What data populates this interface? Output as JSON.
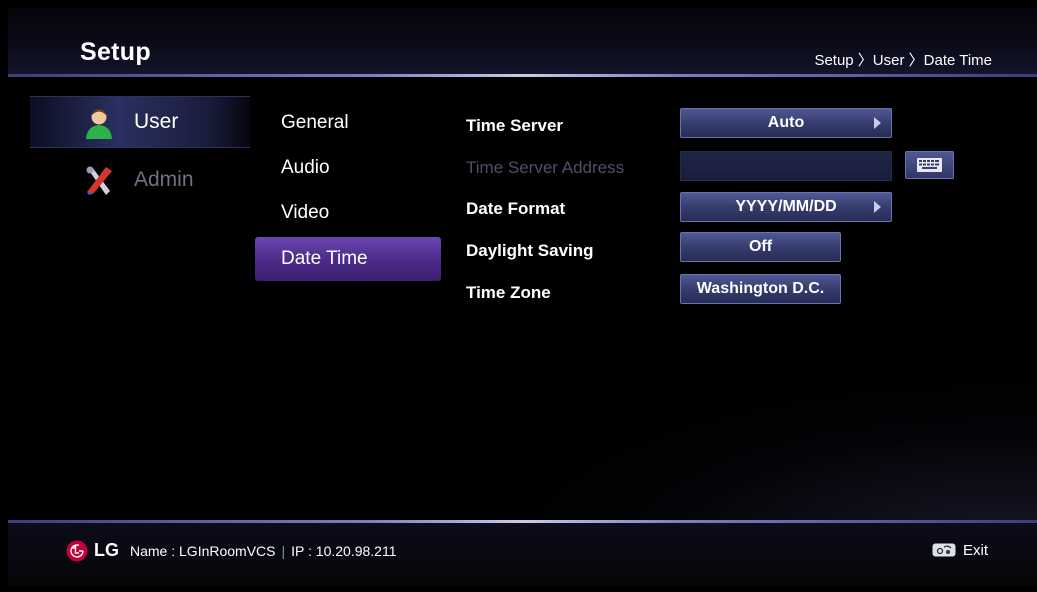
{
  "header": {
    "title": "Setup",
    "breadcrumb": "Setup 〉User 〉Date Time"
  },
  "categories": [
    {
      "label": "User",
      "icon": "user-icon",
      "active": true
    },
    {
      "label": "Admin",
      "icon": "tools-icon",
      "active": false
    }
  ],
  "submenu": [
    {
      "label": "General"
    },
    {
      "label": "Audio"
    },
    {
      "label": "Video"
    },
    {
      "label": "Date Time",
      "selected": true
    }
  ],
  "settings": {
    "time_server": {
      "label": "Time Server",
      "value": "Auto"
    },
    "time_server_address": {
      "label": "Time Server Address",
      "value": "",
      "enabled": false
    },
    "date_format": {
      "label": "Date Format",
      "value": "YYYY/MM/DD"
    },
    "daylight_saving": {
      "label": "Daylight Saving",
      "value": "Off"
    },
    "time_zone": {
      "label": "Time Zone",
      "value": "Washington D.C."
    }
  },
  "footer": {
    "brand": "LG",
    "name": "Name : LGInRoomVCS",
    "ip": "IP : 10.20.98.211",
    "exit_label": "Exit"
  },
  "colors": {
    "accent_purple": "#5b3a9e",
    "button_blue": "#363d6e",
    "header_line": "#c9cbe6",
    "lg_red": "#c4003a"
  }
}
